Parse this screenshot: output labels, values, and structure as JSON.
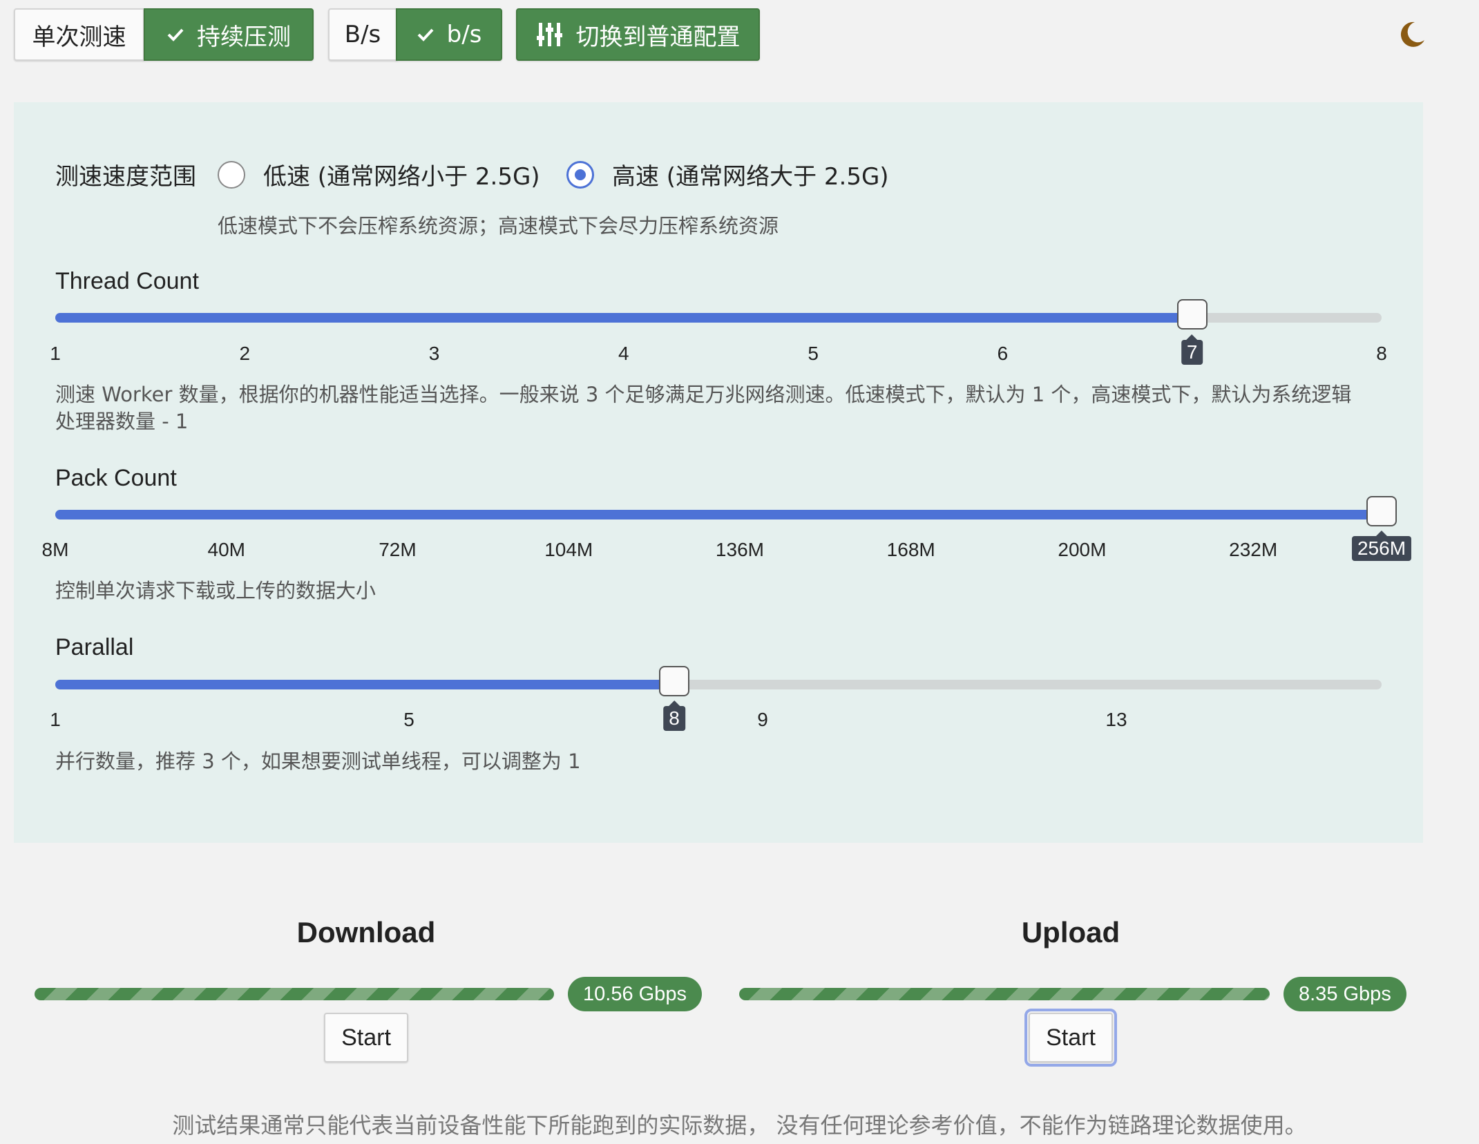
{
  "toolbar": {
    "single_test": "单次测速",
    "continuous_test": "持续压测",
    "unit_bytes": "B/s",
    "unit_bits": "b/s",
    "switch_config": "切换到普通配置"
  },
  "config": {
    "range_label": "测速速度范围",
    "low_speed": "低速 (通常网络小于 2.5G)",
    "high_speed": "高速 (通常网络大于 2.5G)",
    "selected": "high",
    "range_hint": "低速模式下不会压榨系统资源；高速模式下会尽力压榨系统资源",
    "thread_count": {
      "title": "Thread Count",
      "min": 1,
      "max": 8,
      "value": 7,
      "ticks": [
        "1",
        "2",
        "3",
        "4",
        "5",
        "6",
        "7",
        "8"
      ],
      "hint_line1": "测速 Worker 数量，根据你的机器性能适当选择。一般来说 3 个足够满足万兆网络测速。低速模式下，默认为 1 个，高速模式下，默认为系统逻辑",
      "hint_line2": "处理器数量 - 1"
    },
    "pack_count": {
      "title": "Pack Count",
      "min": 8,
      "max": 256,
      "value": 256,
      "ticks": [
        "8M",
        "40M",
        "72M",
        "104M",
        "136M",
        "168M",
        "200M",
        "232M",
        "256M"
      ],
      "hint": "控制单次请求下载或上传的数据大小"
    },
    "parallal": {
      "title": "Parallal",
      "min": 1,
      "max": 16,
      "value": 8,
      "ticks": [
        "1",
        "5",
        "8",
        "9",
        "13"
      ],
      "hint": "并行数量，推荐 3 个，如果想要测试单线程，可以调整为 1"
    }
  },
  "download": {
    "title": "Download",
    "speed": "10.56 Gbps",
    "start": "Start",
    "progress": 1.0
  },
  "upload": {
    "title": "Upload",
    "speed": "8.35 Gbps",
    "start": "Start",
    "progress": 1.0
  },
  "footer": "测试结果通常只能代表当前设备性能下所能跑到的实际数据， 没有任何理论参考价值，不能作为链路理论数据使用。",
  "colors": {
    "accent": "#4d72d6",
    "green": "#4b8a4e",
    "moon": "#8a5a12"
  }
}
